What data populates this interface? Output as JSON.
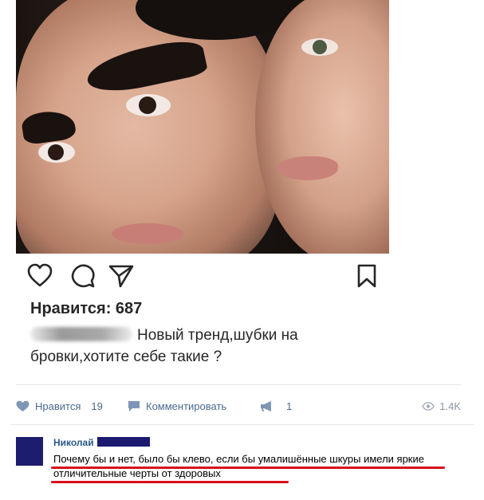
{
  "post": {
    "likes_line": "Нравится: 687",
    "caption": "Новый тренд,шубки на бровки,хотите себе такие ?",
    "icons": [
      "heart-icon",
      "comment-icon",
      "share-icon",
      "bookmark-icon"
    ]
  },
  "vk_bar": {
    "like_label": "Нравится",
    "like_count": "19",
    "comment_label": "Комментировать",
    "share_count": "1",
    "views": "1.4K"
  },
  "comment": {
    "author": "Николай",
    "text": "Почему бы и нет, было бы клево, если бы умалишённые шкуры имели яркие отличительные черты от здоровых"
  },
  "colors": {
    "vk_link": "#4a6a92",
    "author": "#2a5885",
    "underline": "#d9101b"
  }
}
